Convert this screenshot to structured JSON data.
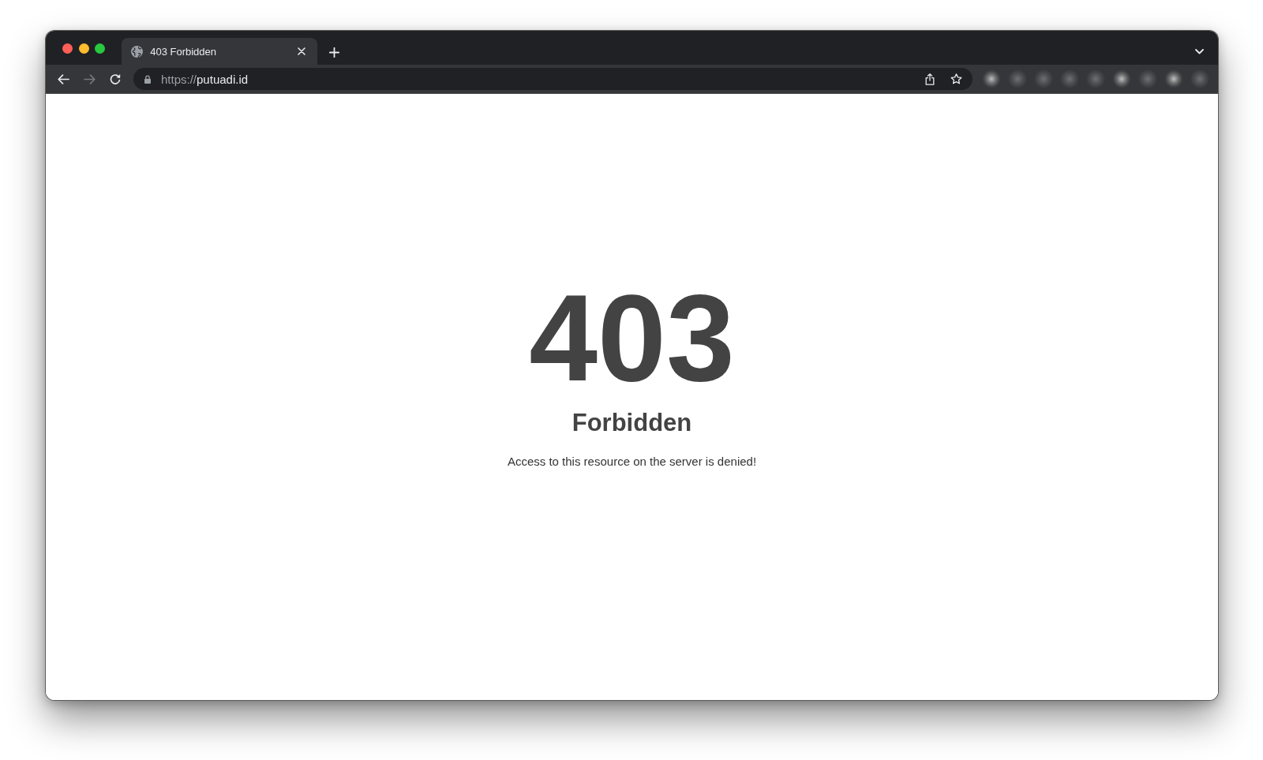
{
  "window_controls": [
    {
      "color": "#ff5f57"
    },
    {
      "color": "#febc2e"
    },
    {
      "color": "#28c840"
    }
  ],
  "tabs": [
    {
      "title": "403 Forbidden",
      "selected": true
    }
  ],
  "nav_buttons": [
    {
      "kind": "back",
      "disabled": false
    },
    {
      "kind": "forward",
      "disabled": true
    },
    {
      "kind": "reload",
      "disabled": false
    }
  ],
  "address_bar": {
    "scheme": "https://",
    "host": "putuadi.id"
  },
  "page": {
    "code": "403",
    "title": "Forbidden",
    "message": "Access to this resource on the server is denied!"
  }
}
